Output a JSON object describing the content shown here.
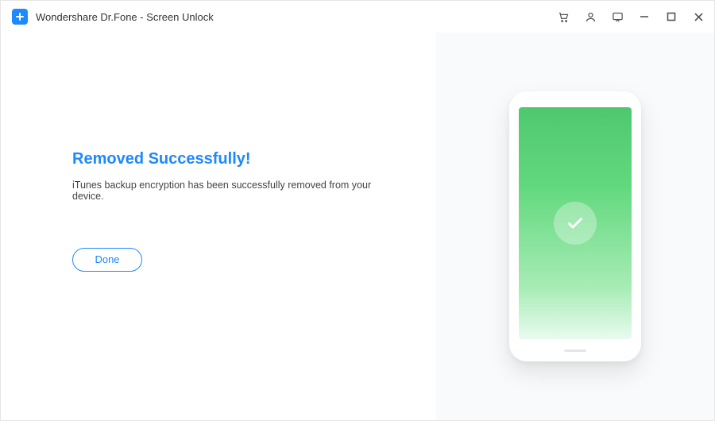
{
  "header": {
    "app_title": "Wondershare Dr.Fone - Screen Unlock"
  },
  "main": {
    "headline": "Removed Successfully!",
    "subtext": "iTunes backup encryption has been successfully removed from your device.",
    "done_label": "Done"
  },
  "icons": {
    "logo": "drfone-logo",
    "cart": "cart-icon",
    "account": "account-icon",
    "feedback": "feedback-icon",
    "minimize": "minimize-icon",
    "maximize": "maximize-icon",
    "close": "close-icon",
    "checkmark": "checkmark-icon"
  },
  "colors": {
    "accent": "#1e88ff",
    "success_gradient_top": "#4ec86f",
    "success_gradient_bottom": "#e9fbef",
    "right_panel_bg": "#f8fafc"
  }
}
